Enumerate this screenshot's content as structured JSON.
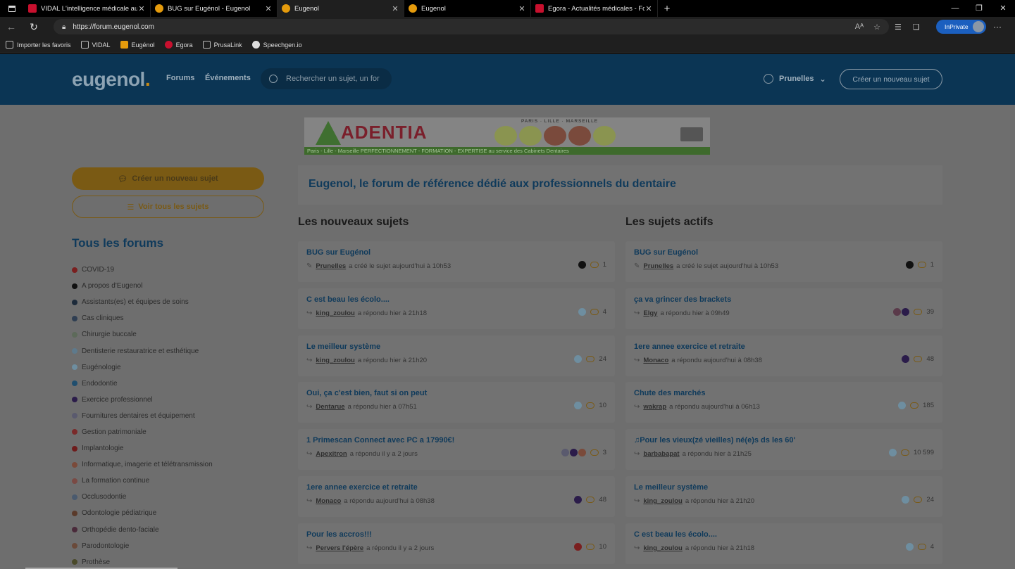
{
  "browser": {
    "tabs": [
      {
        "title": "VIDAL L'intelligence médicale au",
        "favicon": "vidal",
        "active": false
      },
      {
        "title": "BUG sur Eugénol - Eugenol",
        "favicon": "eugenol",
        "active": false
      },
      {
        "title": "Eugenol",
        "favicon": "eugenol",
        "active": true
      },
      {
        "title": "Eugenol",
        "favicon": "eugenol",
        "active": false
      },
      {
        "title": "Egora - Actualités médicales - Fo",
        "favicon": "egora",
        "active": false
      }
    ],
    "url": "https://forum.eugenol.com",
    "inprivate_label": "InPrivate",
    "bookmarks": [
      {
        "label": "Importer les favoris",
        "icon": "import-icon"
      },
      {
        "label": "VIDAL",
        "icon": "page-icon"
      },
      {
        "label": "Eugénol",
        "icon": "eugenol-icon"
      },
      {
        "label": "Egora",
        "icon": "egora-icon"
      },
      {
        "label": "PrusaLink",
        "icon": "page-icon"
      },
      {
        "label": "Speechgen.io",
        "icon": "speech-icon"
      }
    ]
  },
  "header": {
    "logo": "eugenol",
    "logo_dot": ".",
    "nav": [
      "Forums",
      "Événements"
    ],
    "search_placeholder": "Rechercher un sujet, un for",
    "username": "Prunelles",
    "create_button": "Créer un nouveau sujet"
  },
  "banner": {
    "brand": "ADENTIA",
    "cities": "PARIS · LILLE · MARSEILLE",
    "strip": "Paris - Lille - Marseille        PERFECTIONNEMENT - FORMATION - EXPERTISE au service des Cabinets Dentaires"
  },
  "sidebar": {
    "create_button": "Créer un nouveau sujet",
    "view_all_button": "Voir tous les sujets",
    "heading": "Tous les forums",
    "forums": [
      {
        "label": "COVID-19",
        "color": "#7a1f1f"
      },
      {
        "label": "A propos d'Eugenol",
        "color": "#111111"
      },
      {
        "label": "Assistants(es) et équipes de soins",
        "color": "#1c2a3a"
      },
      {
        "label": "Cas cliniques",
        "color": "#2f3e52"
      },
      {
        "label": "Chirurgie buccale",
        "color": "#5d6a5a"
      },
      {
        "label": "Dentisterie restauratrice et esthétique",
        "color": "#5e7a8c"
      },
      {
        "label": "Eugénologie",
        "color": "#6e8ea0"
      },
      {
        "label": "Endodontie",
        "color": "#1f4e6e"
      },
      {
        "label": "Exercice professionnel",
        "color": "#2b1c4a"
      },
      {
        "label": "Fournitures dentaires et équipement",
        "color": "#5a5a6e"
      },
      {
        "label": "Gestion patrimoniale",
        "color": "#7a2a2a"
      },
      {
        "label": "Implantologie",
        "color": "#6e1c1c"
      },
      {
        "label": "Informatique, imagerie et télétransmission",
        "color": "#7a4a3a"
      },
      {
        "label": "La formation continue",
        "color": "#7a4a44"
      },
      {
        "label": "Occlusodontie",
        "color": "#4a5a6e"
      },
      {
        "label": "Odontologie pédiatrique",
        "color": "#5a3a2a"
      },
      {
        "label": "Orthopédie dento-faciale",
        "color": "#4a2a3a"
      },
      {
        "label": "Parodontologie",
        "color": "#6a4a3a"
      },
      {
        "label": "Prothèse",
        "color": "#4a4a2a"
      }
    ]
  },
  "main": {
    "welcome": "Eugenol, le forum de référence dédié aux professionnels du dentaire",
    "new_topics_heading": "Les nouveaux sujets",
    "active_topics_heading": "Les sujets actifs",
    "new_topics": [
      {
        "title": "BUG sur Eugénol",
        "icon": "pencil-icon",
        "user": "Prunelles",
        "action": "a créé le sujet aujourd'hui à 10h53",
        "count": "1",
        "avatars": [
          "#111111"
        ]
      },
      {
        "title": "C est beau les écolo....",
        "icon": "reply-icon",
        "user": "king_zoulou",
        "action": "a répondu hier à 21h18",
        "count": "4",
        "avatars": [
          "#6e8ea0"
        ]
      },
      {
        "title": "Le meilleur système",
        "icon": "reply-icon",
        "user": "king_zoulou",
        "action": "a répondu hier à 21h20",
        "count": "24",
        "avatars": [
          "#6e8ea0"
        ]
      },
      {
        "title": "Oui, ça c'est bien, faut si on peut",
        "icon": "reply-icon",
        "user": "Dentarue",
        "action": "a répondu hier à 07h51",
        "count": "10",
        "avatars": [
          "#6e8ea0"
        ]
      },
      {
        "title": "1 Primescan Connect avec PC a 17990€!",
        "icon": "reply-icon",
        "user": "Apexitron",
        "action": "a répondu il y a 2 jours",
        "count": "3",
        "avatars": [
          "#5a5a6e",
          "#2b1c4a",
          "#7a4a3a"
        ]
      },
      {
        "title": "1ere annee exercice et retraite",
        "icon": "reply-icon",
        "user": "Monaco",
        "action": "a répondu aujourd'hui à 08h38",
        "count": "48",
        "avatars": [
          "#2b1c4a"
        ]
      },
      {
        "title": "Pour les accros!!!",
        "icon": "reply-icon",
        "user": "Pervers l'épère",
        "action": "a répondu il y a 2 jours",
        "count": "10",
        "avatars": [
          "#7a1f1f"
        ]
      }
    ],
    "active_topics": [
      {
        "title": "BUG sur Eugénol",
        "icon": "pencil-icon",
        "user": "Prunelles",
        "action": "a créé le sujet aujourd'hui à 10h53",
        "count": "1",
        "avatars": [
          "#111111"
        ]
      },
      {
        "title": "ça va grincer des brackets",
        "icon": "reply-icon",
        "user": "Elgy",
        "action": "a répondu hier à 09h49",
        "count": "39",
        "avatars": [
          "#5a3a4a",
          "#2b1c4a"
        ]
      },
      {
        "title": "1ere annee exercice et retraite",
        "icon": "reply-icon",
        "user": "Monaco",
        "action": "a répondu aujourd'hui à 08h38",
        "count": "48",
        "avatars": [
          "#2b1c4a"
        ]
      },
      {
        "title": "Chute des marchés",
        "icon": "reply-icon",
        "user": "wakrap",
        "action": "a répondu aujourd'hui à 06h13",
        "count": "185",
        "avatars": [
          "#6e8ea0"
        ]
      },
      {
        "title": "♫Pour les vieux(zé vieilles) né(e)s ds les 60'",
        "icon": "reply-icon",
        "user": "barbabapat",
        "action": "a répondu hier à 21h25",
        "count": "10 599",
        "avatars": [
          "#6e8ea0"
        ]
      },
      {
        "title": "Le meilleur système",
        "icon": "reply-icon",
        "user": "king_zoulou",
        "action": "a répondu hier à 21h20",
        "count": "24",
        "avatars": [
          "#6e8ea0"
        ]
      },
      {
        "title": "C est beau les écolo....",
        "icon": "reply-icon",
        "user": "king_zoulou",
        "action": "a répondu hier à 21h18",
        "count": "4",
        "avatars": [
          "#6e8ea0"
        ]
      }
    ]
  }
}
